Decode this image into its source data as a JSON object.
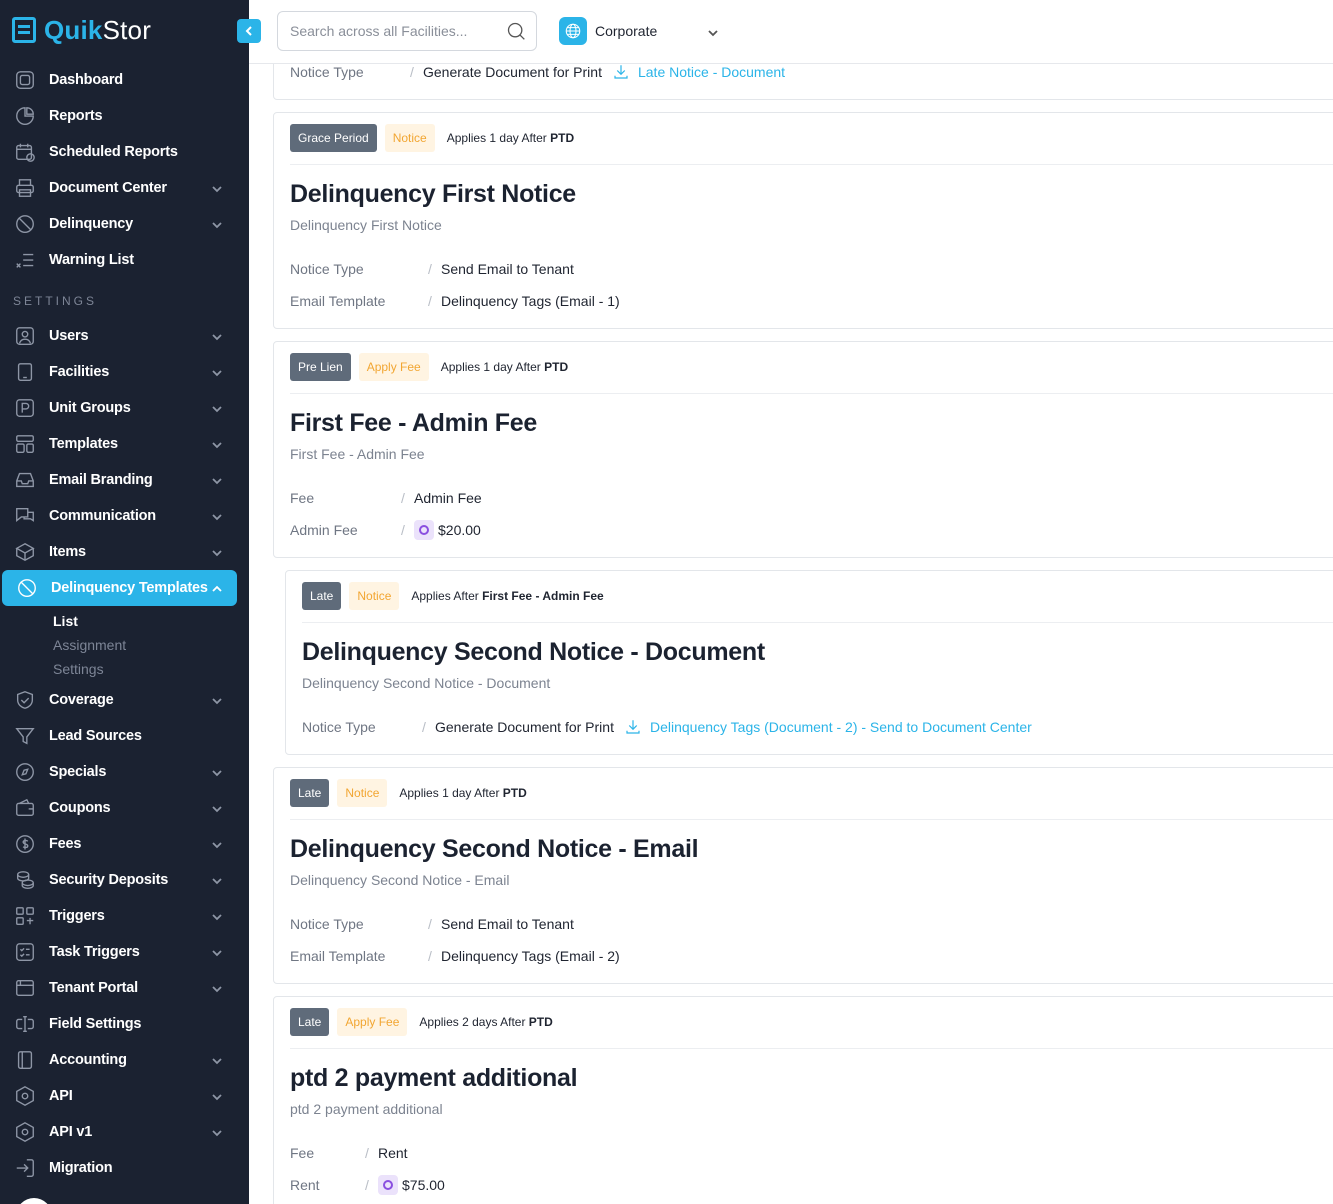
{
  "app": {
    "logo_quik": "Quik",
    "logo_stor": "Stor"
  },
  "sidebar": {
    "items": [
      {
        "label": "Dashboard"
      },
      {
        "label": "Reports"
      },
      {
        "label": "Scheduled Reports"
      },
      {
        "label": "Document Center"
      },
      {
        "label": "Delinquency"
      },
      {
        "label": "Warning List"
      }
    ],
    "settings_heading": "SETTINGS",
    "settings_items": [
      {
        "label": "Users"
      },
      {
        "label": "Facilities"
      },
      {
        "label": "Unit Groups"
      },
      {
        "label": "Templates"
      },
      {
        "label": "Email Branding"
      },
      {
        "label": "Communication"
      },
      {
        "label": "Items"
      },
      {
        "label": "Delinquency Templates"
      },
      {
        "label": "Coverage"
      },
      {
        "label": "Lead Sources"
      },
      {
        "label": "Specials"
      },
      {
        "label": "Coupons"
      },
      {
        "label": "Fees"
      },
      {
        "label": "Security Deposits"
      },
      {
        "label": "Triggers"
      },
      {
        "label": "Task Triggers"
      },
      {
        "label": "Tenant Portal"
      },
      {
        "label": "Field Settings"
      },
      {
        "label": "Accounting"
      },
      {
        "label": "API"
      },
      {
        "label": "API v1"
      },
      {
        "label": "Migration"
      }
    ],
    "sub_items": [
      {
        "label": "List"
      },
      {
        "label": "Assignment"
      },
      {
        "label": "Settings"
      }
    ]
  },
  "topbar": {
    "search_placeholder": "Search across all Facilities...",
    "facility": "Corporate"
  },
  "cards": [
    {
      "rows": [
        {
          "label": "Notice Type",
          "sep": "/",
          "value": "Generate Document for Print",
          "link": "Late Notice - Document"
        }
      ]
    },
    {
      "badge1": "Grace Period",
      "badge2": "Notice",
      "applies_prefix": "Applies 1 day After ",
      "applies_bold": "PTD",
      "title": "Delinquency First Notice",
      "subtitle": "Delinquency First Notice",
      "rows": [
        {
          "label": "Notice Type",
          "sep": "/",
          "value": "Send Email to Tenant"
        },
        {
          "label": "Email Template",
          "sep": "/",
          "value": "Delinquency Tags (Email - 1)"
        }
      ]
    },
    {
      "badge1": "Pre Lien",
      "badge2": "Apply Fee",
      "applies_prefix": "Applies 1 day After ",
      "applies_bold": "PTD",
      "title": "First Fee - Admin Fee",
      "subtitle": "First Fee - Admin Fee",
      "rows": [
        {
          "label": "Fee",
          "sep": "/",
          "value": "Admin Fee"
        },
        {
          "label": "Admin Fee",
          "sep": "/",
          "value": "$20.00"
        }
      ]
    },
    {
      "badge1": "Late",
      "badge2": "Notice",
      "applies_prefix": "Applies After ",
      "applies_bold": "First Fee - Admin Fee",
      "title": "Delinquency Second Notice - Document",
      "subtitle": "Delinquency Second Notice - Document",
      "rows": [
        {
          "label": "Notice Type",
          "sep": "/",
          "value": "Generate Document for Print",
          "link": "Delinquency Tags (Document - 2) - Send to Document Center"
        }
      ]
    },
    {
      "badge1": "Late",
      "badge2": "Notice",
      "applies_prefix": "Applies 1 day After ",
      "applies_bold": "PTD",
      "title": "Delinquency Second Notice - Email",
      "subtitle": "Delinquency Second Notice - Email",
      "rows": [
        {
          "label": "Notice Type",
          "sep": "/",
          "value": "Send Email to Tenant"
        },
        {
          "label": "Email Template",
          "sep": "/",
          "value": "Delinquency Tags (Email - 2)"
        }
      ]
    },
    {
      "badge1": "Late",
      "badge2": "Apply Fee",
      "applies_prefix": "Applies 2 days After ",
      "applies_bold": "PTD",
      "title": "ptd 2 payment additional",
      "subtitle": "ptd 2 payment additional",
      "rows": [
        {
          "label": "Fee",
          "sep": "/",
          "value": "Rent"
        },
        {
          "label": "Rent",
          "sep": "/",
          "value": "$75.00"
        }
      ]
    }
  ]
}
